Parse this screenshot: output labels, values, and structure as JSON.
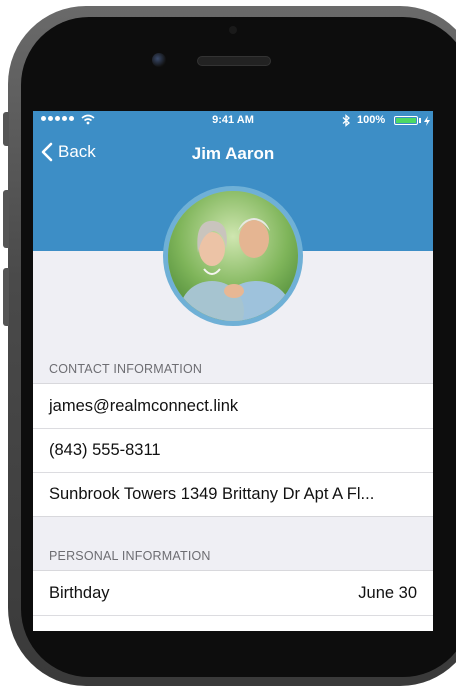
{
  "status_bar": {
    "time": "9:41 AM",
    "battery": "100%",
    "signal_icon": "signal-dots-icon",
    "wifi_icon": "wifi-icon",
    "bluetooth_icon": "bluetooth-icon",
    "battery_icon": "battery-icon",
    "battery_level": 1.0
  },
  "nav": {
    "back_label": "Back",
    "title": "Jim Aaron"
  },
  "colors": {
    "header": "#3d8ec6",
    "background": "#efeff4"
  },
  "contact_section": {
    "header": "CONTACT INFORMATION",
    "rows": [
      {
        "value": "james@realmconnect.link"
      },
      {
        "value": "(843) 555-8311"
      },
      {
        "value": "Sunbrook Towers 1349 Brittany Dr Apt A Fl..."
      }
    ]
  },
  "personal_section": {
    "header": "PERSONAL INFORMATION",
    "rows": [
      {
        "label": "Birthday",
        "value": "June 30"
      }
    ]
  }
}
